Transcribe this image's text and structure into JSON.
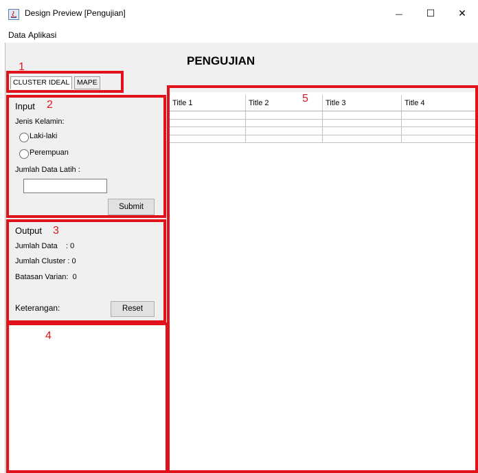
{
  "window": {
    "title": "Design Preview [Pengujian]",
    "minimize_glyph": "—",
    "maximize_glyph": "☐",
    "close_glyph": "✕"
  },
  "menubar": {
    "items": [
      "Data",
      "Aplikasi"
    ]
  },
  "page": {
    "title": "PENGUJIAN"
  },
  "tabs": [
    {
      "label": "CLUSTER IDEAL",
      "selected": true
    },
    {
      "label": "MAPE",
      "selected": false
    }
  ],
  "input_panel": {
    "heading": "Input",
    "gender_label": "Jenis Kelamin:",
    "options": [
      "Laki-laki",
      "Perempuan"
    ],
    "train_label": "Jumlah Data Latih  :",
    "train_value": "",
    "submit_label": "Submit"
  },
  "output_panel": {
    "heading": "Output",
    "jumlah_data": "Jumlah Data    : 0",
    "jumlah_cluster": "Jumlah Cluster : 0",
    "batasan_varian": "Batasan Varian:  0",
    "keterangan_label": "Keterangan:",
    "reset_label": "Reset"
  },
  "table": {
    "columns": [
      "Title 1",
      "Title 2",
      "Title 3",
      "Title 4"
    ],
    "rows": [
      [
        "",
        "",
        "",
        ""
      ],
      [
        "",
        "",
        "",
        ""
      ],
      [
        "",
        "",
        "",
        ""
      ],
      [
        "",
        "",
        "",
        ""
      ]
    ]
  },
  "annotations": [
    "1",
    "2",
    "3",
    "4",
    "5"
  ],
  "colors": {
    "annotation": "#e0131a",
    "panel_bg": "#f0f0f0"
  }
}
